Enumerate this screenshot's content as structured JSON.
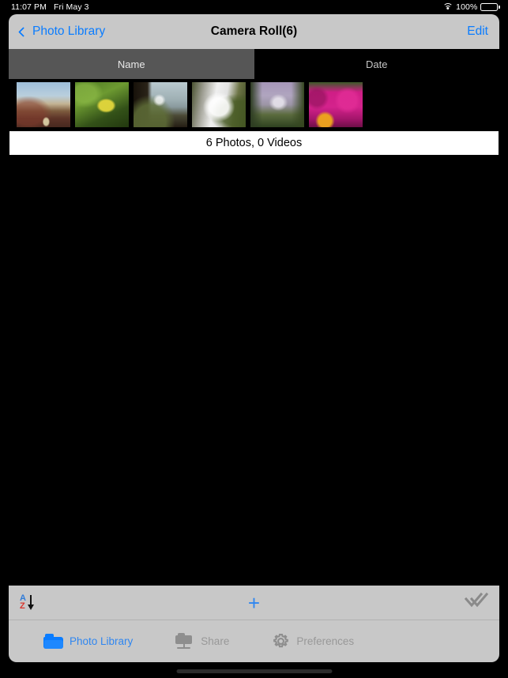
{
  "status_bar": {
    "time": "11:07 PM",
    "date": "Fri May 3",
    "wifi_icon": "wifi-icon",
    "battery_percent": "100%",
    "battery_icon": "battery-full-icon"
  },
  "nav_bar": {
    "back_icon": "chevron-left-icon",
    "back_label": "Photo Library",
    "title": "Camera Roll(6)",
    "edit_label": "Edit"
  },
  "segmented_control": {
    "selected": "Name",
    "segments": [
      {
        "label": "Name",
        "active": true
      },
      {
        "label": "Date",
        "active": false
      }
    ]
  },
  "thumbnails": [
    {
      "name": "coastal-dunes-grass",
      "sky": "#a7c4dd",
      "mid": "#c3b79b",
      "fg": "#6b3f32",
      "accent": "#e8e0b4"
    },
    {
      "name": "yellow-pepper-plant",
      "sky": "#3f6b1e",
      "mid": "#6e9a31",
      "fg": "#2d4a16",
      "accent": "#e3d73c"
    },
    {
      "name": "waterfall-cliff-river",
      "sky": "#b9c9cf",
      "mid": "#8e9ea2",
      "fg": "#2a2318",
      "accent": "#6b7a4a"
    },
    {
      "name": "white-cascade-moss",
      "sky": "#e9e9e9",
      "mid": "#cfcfcf",
      "fg": "#35401f",
      "accent": "#f5f5f5"
    },
    {
      "name": "waterfall-purple-sky",
      "sky": "#b3a6c4",
      "mid": "#9d93ad",
      "fg": "#2e4220",
      "accent": "#d8d2e0"
    },
    {
      "name": "magenta-flowers",
      "sky": "#3c5a28",
      "mid": "#cf1e86",
      "fg": "#9c1263",
      "accent": "#efa81c"
    }
  ],
  "count_bar": {
    "text": "6 Photos, 0 Videos"
  },
  "toolbar": {
    "sort_icon": "sort-az-descending-icon",
    "sort_letter_a": "A",
    "sort_letter_z": "Z",
    "add_icon": "plus-icon",
    "add_label": "+",
    "select_all_icon": "double-check-icon"
  },
  "tab_bar": {
    "tabs": [
      {
        "label": "Photo Library",
        "icon": "folder-icon",
        "active": true
      },
      {
        "label": "Share",
        "icon": "share-network-folder-icon",
        "active": false
      },
      {
        "label": "Preferences",
        "icon": "gear-icon",
        "active": false
      }
    ]
  },
  "colors": {
    "accent_blue": "#0a7cff",
    "chrome_gray": "#c8c8c8",
    "segment_active": "#565656",
    "background_black": "#000000",
    "inactive_label": "#989898"
  },
  "home_indicator": "home-indicator"
}
